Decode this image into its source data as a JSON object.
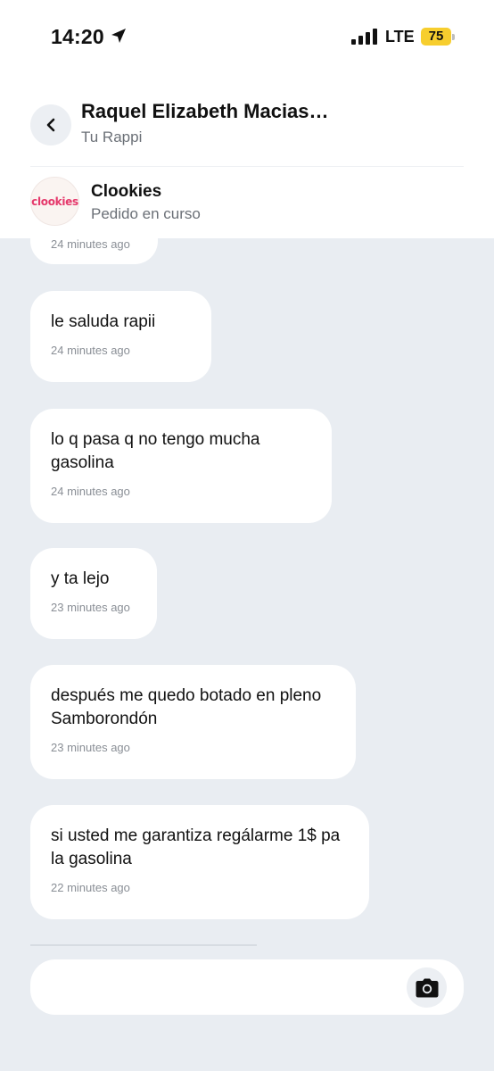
{
  "status_bar": {
    "time": "14:20",
    "network": "LTE",
    "battery": "75",
    "battery_color": "#f7ce2e"
  },
  "header": {
    "contact_name": "Raquel Elizabeth Macias…",
    "contact_subtitle": "Tu Rappi",
    "back_icon": "chevron-left-icon"
  },
  "store": {
    "logo_text": "clookies",
    "name": "Clookies",
    "status": "Pedido en curso"
  },
  "messages": [
    {
      "text": "",
      "time": "24 minutes ago"
    },
    {
      "text": "le saluda rapii",
      "time": "24 minutes ago"
    },
    {
      "text": "lo q pasa q no tengo mucha gasolina",
      "time": "24 minutes ago"
    },
    {
      "text": "y ta lejo",
      "time": "23 minutes ago"
    },
    {
      "text": "después me quedo botado en pleno Samborondón",
      "time": "23 minutes ago"
    },
    {
      "text": "si usted me garantiza regálarme 1$ pa la gasolina",
      "time": "22 minutes ago"
    }
  ],
  "composer": {
    "placeholder": "",
    "camera_icon": "camera-icon"
  }
}
